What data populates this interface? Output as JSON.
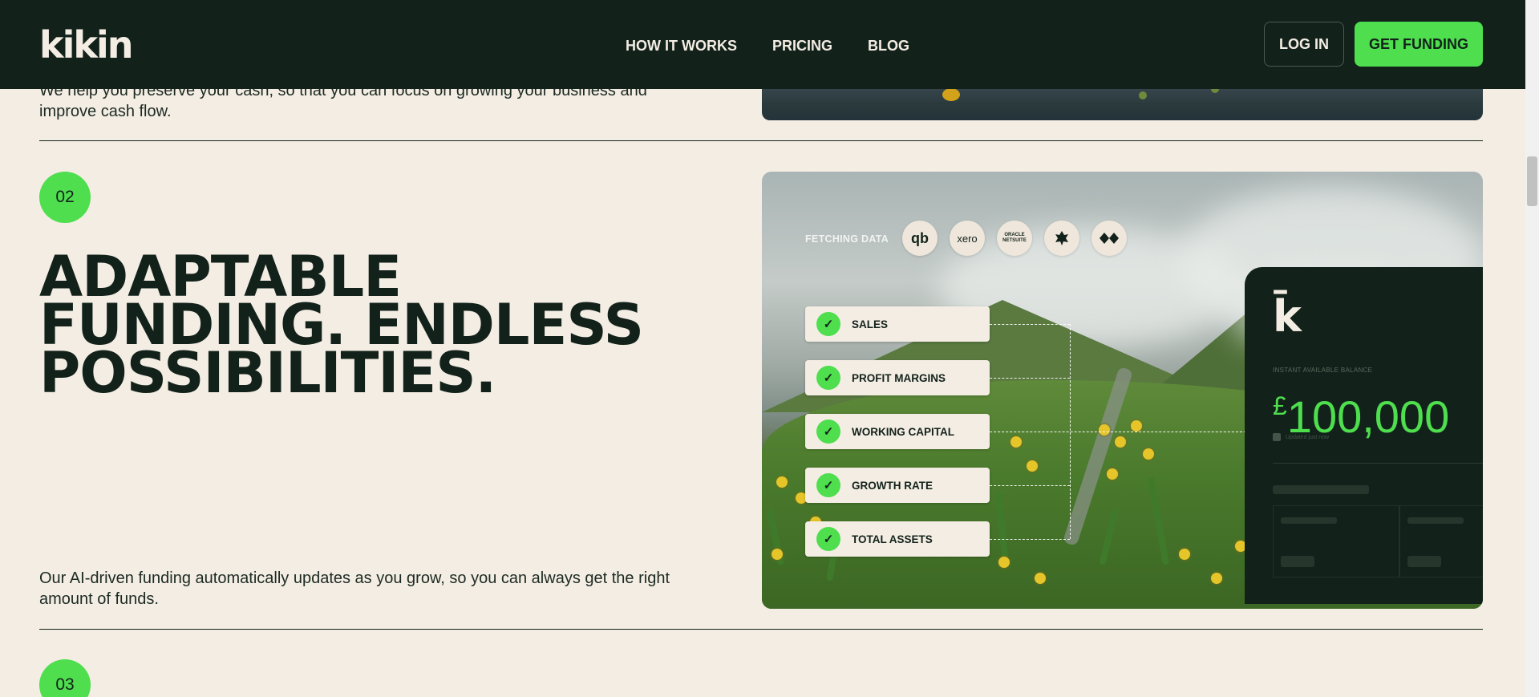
{
  "header": {
    "logo": "kikin",
    "nav": [
      "HOW IT WORKS",
      "PRICING",
      "BLOG"
    ],
    "login_label": "LOG IN",
    "cta_label": "GET FUNDING"
  },
  "previous_section": {
    "body": "We help you preserve your cash, so that you can focus on growing your business and improve cash flow."
  },
  "section": {
    "step": "02",
    "headline": "ADAPTABLE FUNDING. ENDLESS POSSIBILITIES.",
    "body": "Our AI-driven funding automatically updates as you grow, so you can always get the right amount of funds."
  },
  "illustration": {
    "fetching_label": "FETCHING DATA",
    "data_sources": [
      "qb",
      "xero",
      "ORACLE NETSUITE",
      "bank-eagle",
      "hsbc"
    ],
    "metrics": [
      "SALES",
      "PROFIT MARGINS",
      "WORKING CAPITAL",
      "GROWTH RATE",
      "TOTAL ASSETS"
    ],
    "balance_caption": "INSTANT AVAILABLE BALANCE",
    "currency": "£",
    "balance": "100,000",
    "updated_text": "Updated just now"
  },
  "next_section": {
    "step": "03"
  },
  "colors": {
    "background": "#f4ede4",
    "dark": "#12221a",
    "accent": "#4ede4e"
  }
}
